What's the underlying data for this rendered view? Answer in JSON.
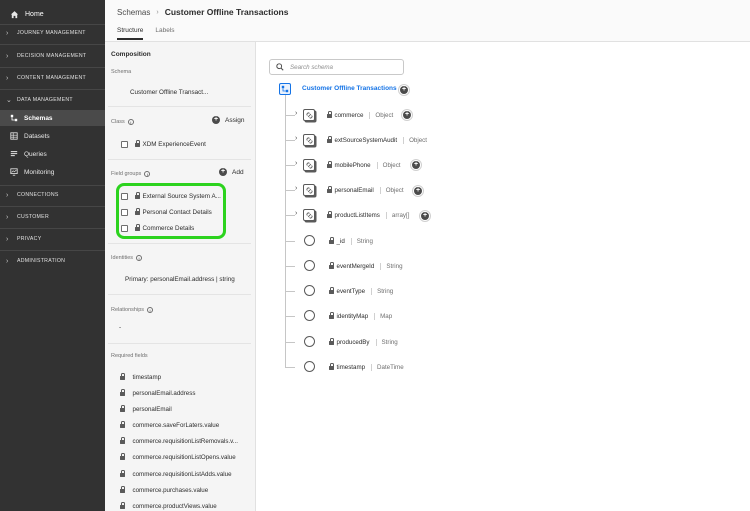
{
  "nav": {
    "home": "Home",
    "sections": {
      "journey": "JOURNEY MANAGEMENT",
      "decision": "DECISION MANAGEMENT",
      "content": "CONTENT MANAGEMENT",
      "data": "DATA MANAGEMENT",
      "connections": "CONNECTIONS",
      "customer": "CUSTOMER",
      "privacy": "PRIVACY",
      "administration": "ADMINISTRATION"
    },
    "data_items": [
      "Schemas",
      "Datasets",
      "Queries",
      "Monitoring"
    ]
  },
  "header": {
    "breadcrumb_root": "Schemas",
    "breadcrumb_current": "Customer Offline Transactions",
    "tabs": [
      "Structure",
      "Labels"
    ]
  },
  "composition": {
    "title": "Composition",
    "schema_label": "Schema",
    "schema_value": "Customer Offline Transact...",
    "class_label": "Class",
    "assign": "Assign",
    "class_value": "XDM ExperienceEvent",
    "field_groups_label": "Field groups",
    "add": "Add",
    "field_groups": [
      "External Source System A...",
      "Personal Contact Details",
      "Commerce Details"
    ],
    "identities_label": "Identities",
    "identities_value": "Primary: personalEmail.address | string",
    "relationships_label": "Relationships",
    "relationships_value": "-",
    "required_label": "Required fields",
    "required_fields": [
      "timestamp",
      "personalEmail.address",
      "personalEmail",
      "commerce.saveForLaters.value",
      "commerce.requisitionListRemovals.v...",
      "commerce.requisitionListOpens.value",
      "commerce.requisitionListAdds.value",
      "commerce.purchases.value",
      "commerce.productViews.value"
    ]
  },
  "tree": {
    "search_placeholder": "Search schema",
    "root": "Customer Offline Transactions",
    "objects": [
      {
        "name": "commerce",
        "type": "Object"
      },
      {
        "name": "extSourceSystemAudit",
        "type": "Object"
      },
      {
        "name": "mobilePhone",
        "type": "Object"
      },
      {
        "name": "personalEmail",
        "type": "Object"
      },
      {
        "name": "productListItems",
        "type": "array[]"
      }
    ],
    "fields": [
      {
        "name": "_id",
        "type": "String"
      },
      {
        "name": "eventMergeId",
        "type": "String"
      },
      {
        "name": "eventType",
        "type": "String"
      },
      {
        "name": "identityMap",
        "type": "Map"
      },
      {
        "name": "producedBy",
        "type": "String"
      },
      {
        "name": "timestamp",
        "type": "DateTime"
      }
    ]
  },
  "colors": {
    "accent": "#1473e6",
    "highlight": "#2cd31e",
    "nav_bg": "#323232"
  }
}
